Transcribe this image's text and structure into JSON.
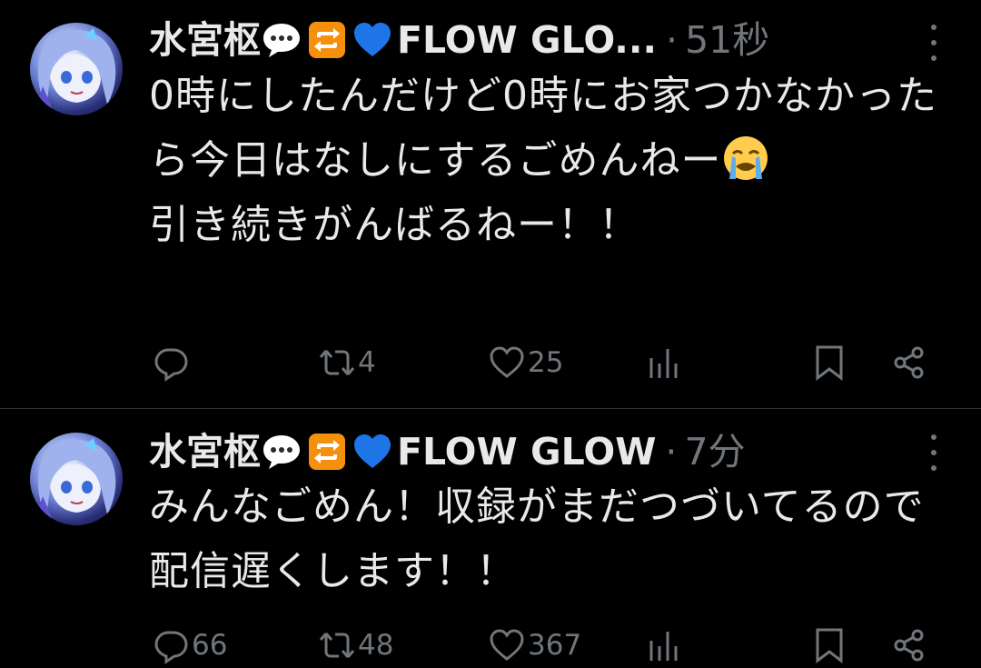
{
  "tweets": [
    {
      "author_name": "水宮枢",
      "author_suffix": "FLOW GLO...",
      "separator": "·",
      "time": "51秒",
      "text_before_emoji": "0時にしたんだけど0時にお家つかなかったら今日はなしにするごめんねー",
      "emoji": "loudly-crying-face",
      "text_after_emoji": "\n引き続きがんばるねー！！",
      "reply_count": "",
      "retweet_count": "4",
      "like_count": "25"
    },
    {
      "author_name": "水宮枢",
      "author_suffix": "FLOW GLOW",
      "separator": "·",
      "time": "7分",
      "text": "みんなごめん！収録がまだつづいてるので配信遅くします！！",
      "reply_count": "66",
      "retweet_count": "48",
      "like_count": "367"
    }
  ],
  "name_emojis": [
    "speech-balloon",
    "repeat-button",
    "blue-heart"
  ],
  "icons": [
    "reply-icon",
    "retweet-icon",
    "like-icon",
    "views-icon",
    "bookmark-icon",
    "share-icon",
    "more-icon"
  ],
  "colors": {
    "background": "#000000",
    "text": "#e7e9ea",
    "muted": "#71767b",
    "divider": "#2f3336",
    "heart_blue": "#1d75e8",
    "repeat_orange": "#f4900c"
  }
}
